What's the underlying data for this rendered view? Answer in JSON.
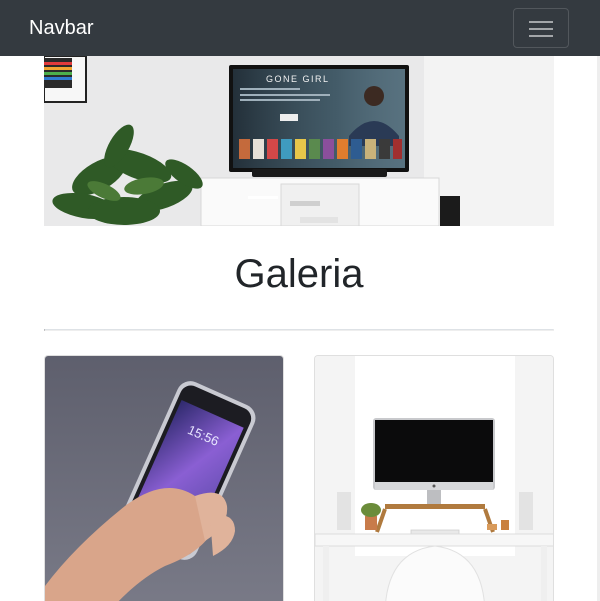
{
  "navbar": {
    "brand": "Navbar",
    "toggler_icon": "hamburger-menu-icon"
  },
  "hero": {
    "tv_screen_title": "GONE GIRL"
  },
  "main": {
    "heading": "Galeria"
  },
  "gallery": {
    "cards": [
      {
        "phone_time": "15:56"
      },
      {
        "subject": "desk-workspace"
      }
    ]
  },
  "colors": {
    "navbar_bg": "#343a40",
    "brand_text": "#ffffff",
    "heading_text": "#212529"
  }
}
